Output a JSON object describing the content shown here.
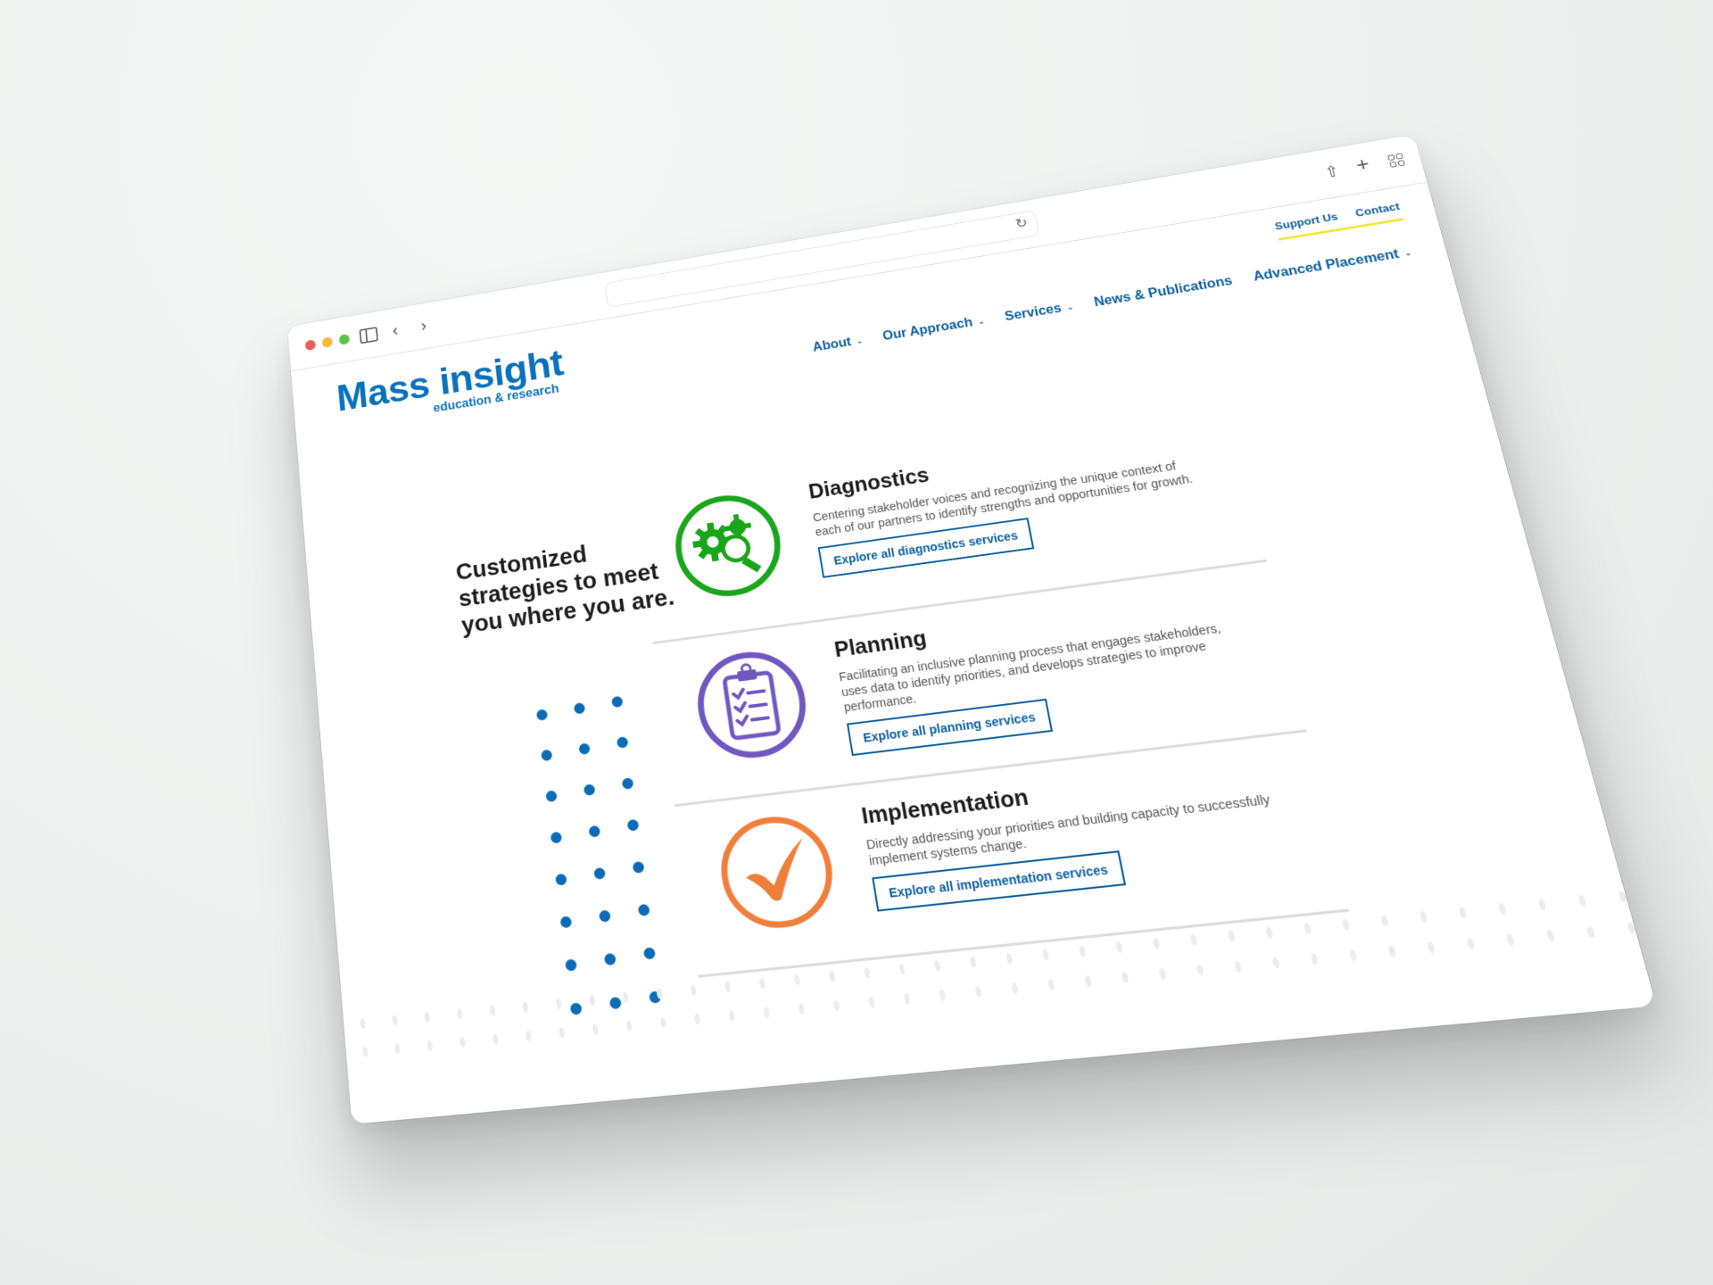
{
  "browser": {
    "controls": {
      "close": "red",
      "minimize": "yellow",
      "maximize": "green"
    },
    "icons": [
      "sidebar-toggle-icon",
      "back-arrow-icon",
      "forward-arrow-icon",
      "reload-icon",
      "share-icon",
      "new-tab-plus-icon",
      "tab-overview-grid-icon"
    ],
    "address_value": "",
    "glyphs": {
      "back": "‹",
      "forward": "›",
      "reload": "↻",
      "share": "⇧",
      "plus": "+"
    }
  },
  "site": {
    "logo": {
      "main": "Mass insight",
      "sub": "education & research",
      "color": "#0a72bb"
    },
    "utility_nav": [
      {
        "label": "Support Us"
      },
      {
        "label": "Contact"
      }
    ],
    "utility_underline_color": "#f2e63a",
    "main_nav": [
      {
        "label": "About",
        "has_dropdown": true
      },
      {
        "label": "Our Approach",
        "has_dropdown": true
      },
      {
        "label": "Services",
        "has_dropdown": true
      },
      {
        "label": "News & Publications",
        "has_dropdown": false
      },
      {
        "label": "Advanced Placement",
        "has_dropdown": true
      }
    ],
    "chevron": "⌄",
    "nav_color": "#0b5e9f"
  },
  "content": {
    "tagline": "Customized strategies to meet you where you are.",
    "services": [
      {
        "title": "Diagnostics",
        "description": "Centering stakeholder voices and recognizing the unique context of each of our partners to identify strengths and opportunities for growth.",
        "button": "Explore all diagnostics services",
        "icon": "gears-magnifier-icon",
        "color": "#1aa51a"
      },
      {
        "title": "Planning",
        "description": "Facilitating an inclusive planning process that engages stakeholders, uses data to identify priorities, and develops strategies to improve performance.",
        "button": "Explore all planning services",
        "icon": "clipboard-checklist-icon",
        "color": "#6e58c0"
      },
      {
        "title": "Implementation",
        "description": "Directly addressing your priorities and building capacity to successfully implement systems change.",
        "button": "Explore all implementation services",
        "icon": "checkmark-icon",
        "color": "#f07f3c"
      }
    ],
    "decorative_dots_color": "#0a6cb8"
  }
}
